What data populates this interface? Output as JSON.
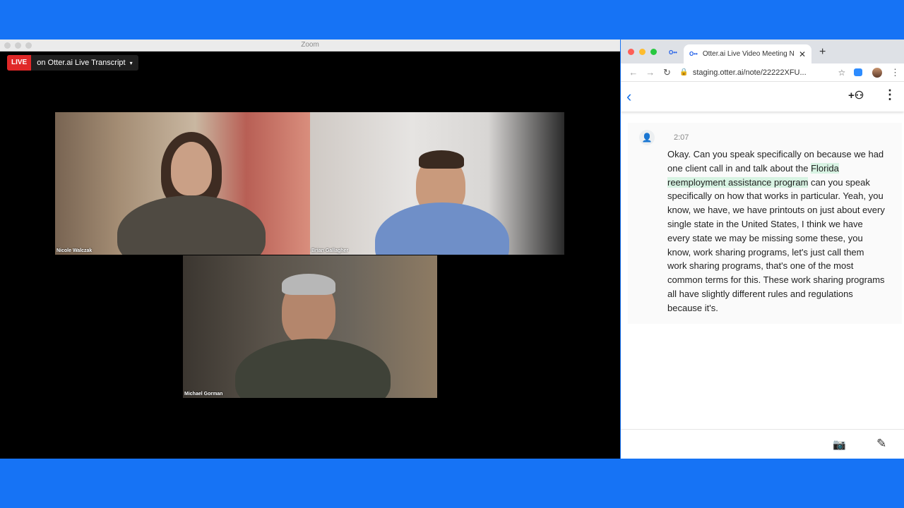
{
  "zoom": {
    "window_title": "Zoom",
    "live_badge": "LIVE",
    "live_label": "on Otter.ai Live Transcript",
    "live_caret": "▾",
    "participants": [
      "Nicole Walczak",
      "Brian Gallagher",
      "Michael Gorman"
    ]
  },
  "browser": {
    "pinned_tab_icon": "O••",
    "tab_icon": "O••",
    "tab_title": "Otter.ai Live Video Meeting No",
    "tab_close": "✕",
    "new_tab": "+",
    "back": "←",
    "forward": "→",
    "reload": "↻",
    "lock": "🔒",
    "url": "staging.otter.ai/note/22222XFU...",
    "star": "☆",
    "menu": "⋮"
  },
  "otter": {
    "back_icon": "‹",
    "add_person_icon": "+⚇",
    "more_icon": "⋮",
    "transcript": {
      "speaker_icon": "👤",
      "timestamp": "2:07",
      "text_before": "Okay. Can you speak specifically on because we had one client call in and talk about the ",
      "highlight": "Florida reemployment assistance program",
      "text_after": " can you speak specifically on how that works in particular. Yeah, you know, we have, we have printouts on just about every single state in the United States, I think we have every state we may be missing some these, you know, work sharing programs, let's just call them work sharing programs, that's one of the most common terms for this. These work sharing programs all have slightly different rules and regulations because it's."
    },
    "camera_icon": "📷",
    "pen_icon": "✎"
  },
  "colors": {
    "background": "#1673f5",
    "live_red": "#e02828",
    "otter_blue": "#1a73e8",
    "highlight_green": "#d8f3e3"
  }
}
